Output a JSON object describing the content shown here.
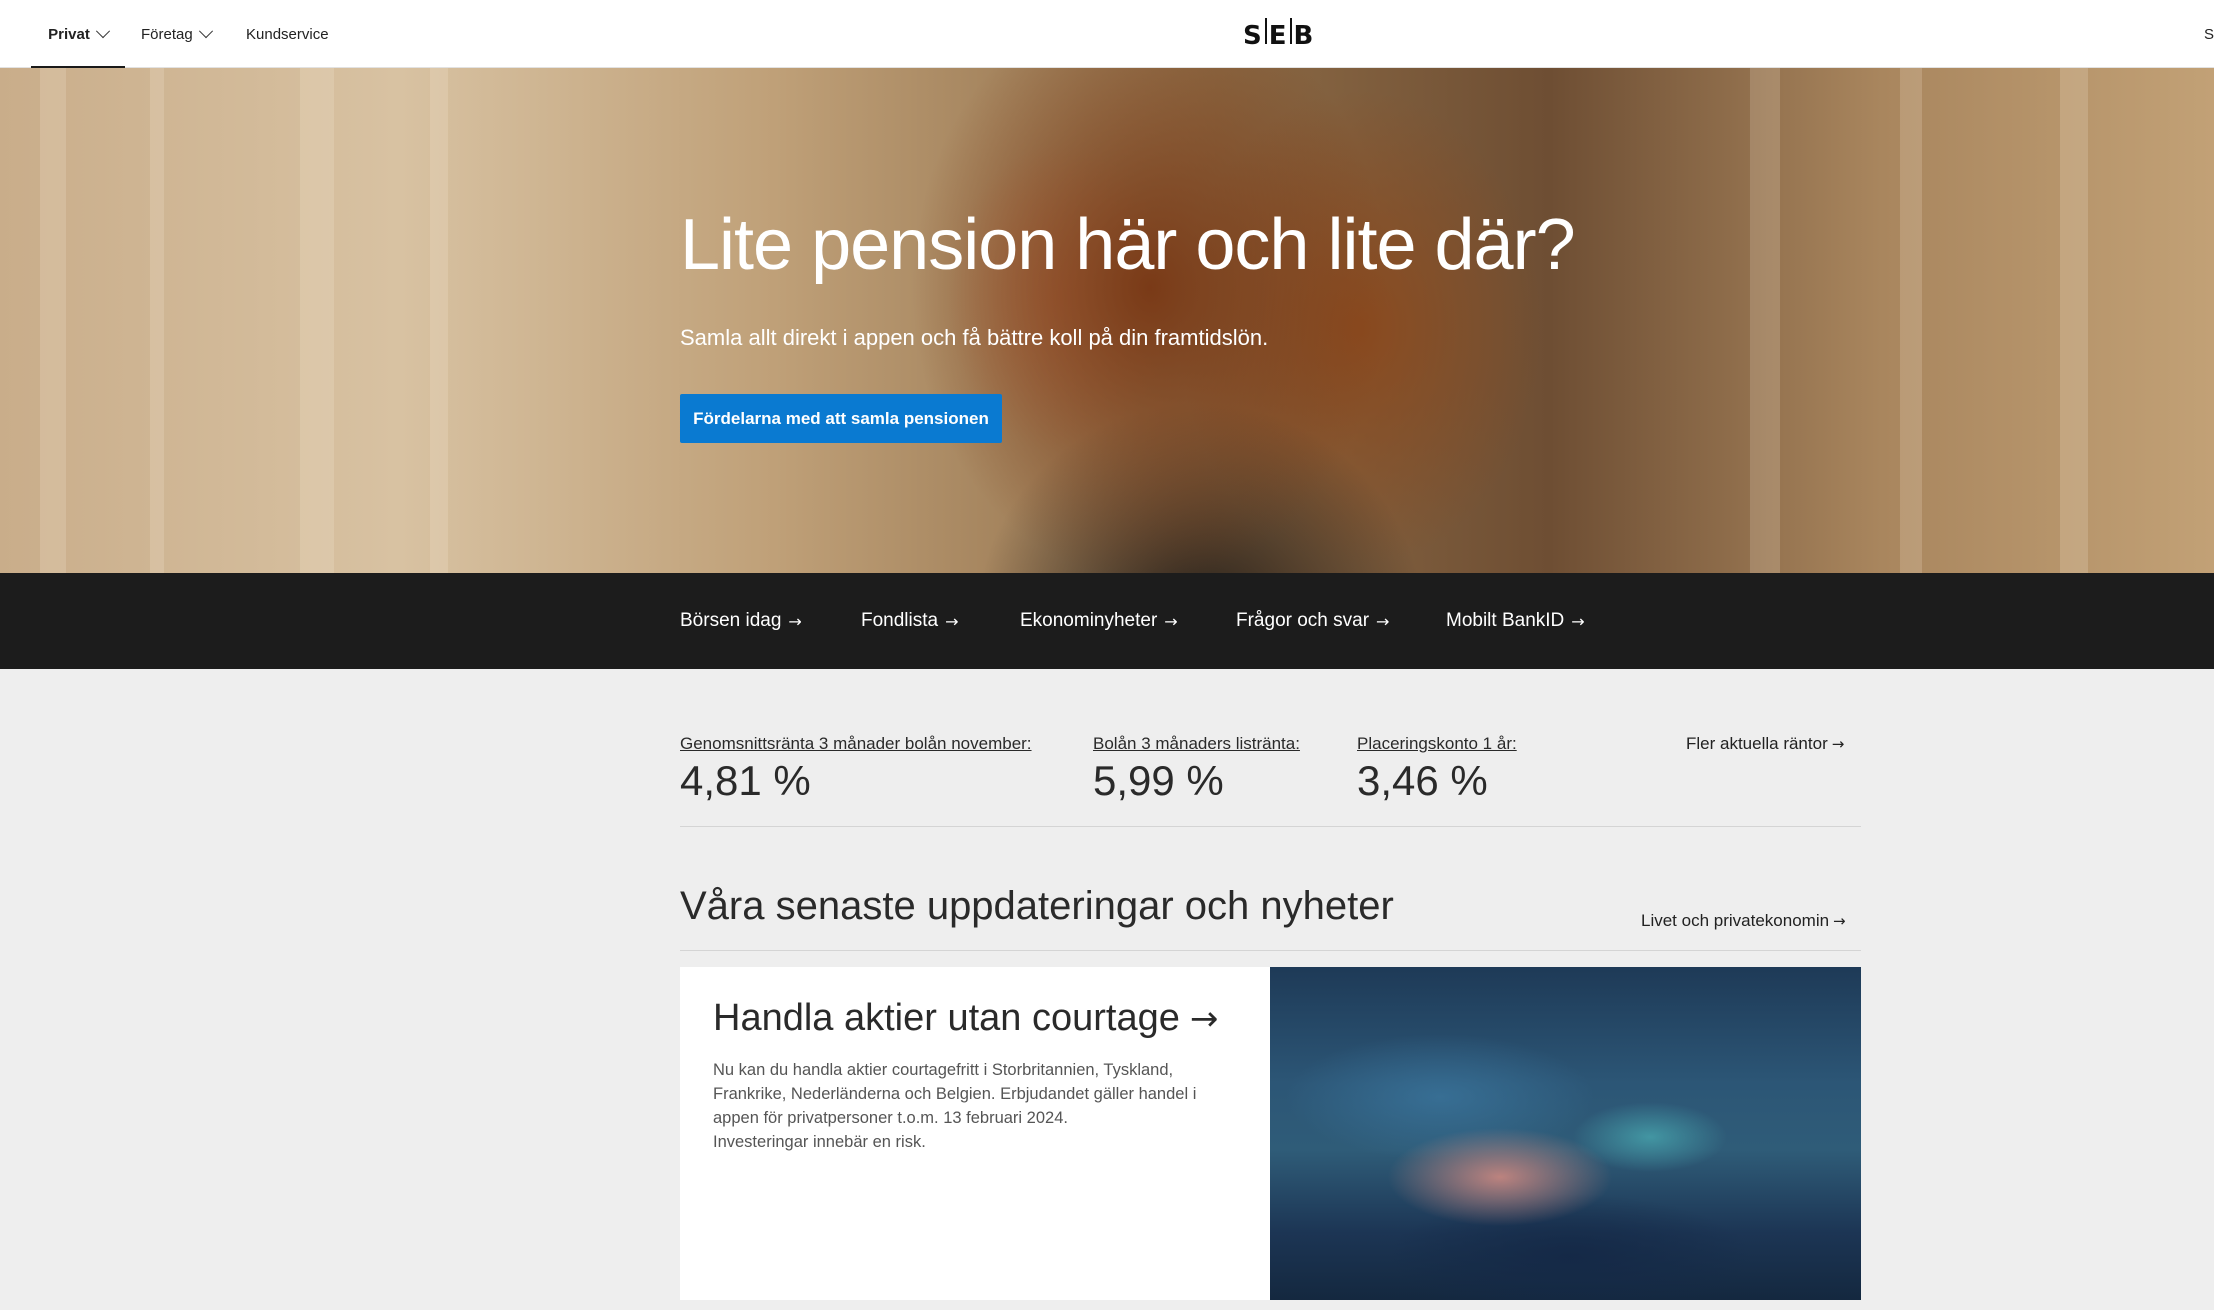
{
  "nav": {
    "items": [
      {
        "label": "Privat",
        "has_dropdown": true,
        "active": true
      },
      {
        "label": "Företag",
        "has_dropdown": true
      },
      {
        "label": "Kundservice"
      }
    ],
    "logo_text": "SEB",
    "right_partial": "S"
  },
  "hero": {
    "title": "Lite pension här och lite där?",
    "subtitle": "Samla allt direkt i appen och få bättre koll på din framtidslön.",
    "button_label": "Fördelarna med att samla pensionen"
  },
  "quick_links": [
    {
      "label": "Börsen idag"
    },
    {
      "label": "Fondlista"
    },
    {
      "label": "Ekonominyheter"
    },
    {
      "label": "Frågor och svar"
    },
    {
      "label": "Mobilt BankID"
    }
  ],
  "rates": {
    "items": [
      {
        "label": "Genomsnittsränta 3 månader bolån november:",
        "value": "4,81 %"
      },
      {
        "label": "Bolån 3 månaders listränta:",
        "value": "5,99 %"
      },
      {
        "label": "Placeringskonto 1 år:",
        "value": "3,46 %"
      }
    ],
    "more_label": "Fler aktuella räntor"
  },
  "news": {
    "title": "Våra senaste uppdateringar och nyheter",
    "more_label": "Livet och privatekonomin",
    "card": {
      "title": "Handla aktier utan courtage",
      "description": "Nu kan du handla aktier courtagefritt i Storbritannien, Tyskland, Frankrike, Nederländerna och Belgien. Erbjudandet gäller handel i appen för privatpersoner t.o.m. 13 februari 2024.",
      "disclaimer": "Investeringar innebär en risk."
    }
  },
  "icons": {
    "arrow": "arrow-right-icon",
    "chevron": "chevron-down-icon"
  },
  "colors": {
    "primary_button": "#0a7ad1",
    "quick_links_band": "#1c1c1c",
    "page_background": "#eeeeee"
  }
}
